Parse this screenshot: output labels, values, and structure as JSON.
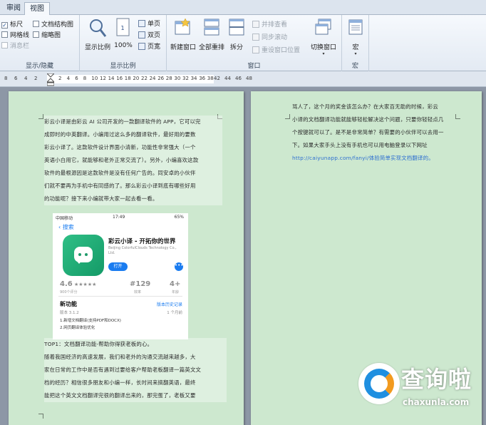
{
  "tabs": [
    {
      "label": "审阅",
      "active": false
    },
    {
      "label": "视图",
      "active": true
    }
  ],
  "ribbon": {
    "show_hide": {
      "label": "显示/隐藏",
      "ruler": {
        "label": "标尺",
        "checked": true
      },
      "gridlines": {
        "label": "网格线",
        "checked": false
      },
      "message_bar": {
        "label": "消息栏",
        "checked": false,
        "enabled": false
      },
      "doc_map": {
        "label": "文档结构图",
        "checked": false
      },
      "thumbnails": {
        "label": "缩略图",
        "checked": false
      }
    },
    "zoom": {
      "label": "显示比例",
      "zoom_button": "显示比例",
      "hundred_button": "100%",
      "one_page": "单页",
      "two_pages": "双页",
      "page_width": "页宽"
    },
    "window": {
      "label": "窗口",
      "new_window": "新建窗口",
      "arrange_all": "全部重排",
      "split": "拆分",
      "side_by_side": "并排查看",
      "sync_scroll": "同步滚动",
      "reset_position": "重设窗口位置",
      "switch_windows": "切换窗口"
    },
    "macros": {
      "label": "宏",
      "macro_button": "宏"
    }
  },
  "ruler": {
    "left_ticks": [
      "8",
      "6",
      "4",
      "2"
    ],
    "main_ticks": [
      "2",
      "4",
      "6",
      "8",
      "10",
      "12",
      "14",
      "16",
      "18",
      "20",
      "22",
      "24",
      "26",
      "28",
      "30",
      "32",
      "34",
      "36",
      "38"
    ],
    "right_ticks": [
      "42",
      "44",
      "46",
      "48"
    ]
  },
  "page1": {
    "para1_lines": [
      "彩云小译是由彩云 AI 公司开发的一款翻译软件的 APP，它可以完",
      "成即时的中英翻译。小编用过这么多的翻译软件，最好用的要数",
      "彩云小译了。这款软件设计界面小清新，功能性非常强大（一个",
      "英语小白用它，就能够和老外正常交流了）。另外，小编喜欢这款",
      "软件的最根源因是这款软件是没有任何广告的。同安卓的小伙伴",
      "们就不要再为手机中有同感的了。那么彩云小译到底有哪些好用",
      "的功能呢？接下来小编就带大家一起去看一看。"
    ],
    "para2_lines": [
      "TOP1：文档翻译功能-帮助你得获老板的心。",
      "随着我国经济的高速发展，我们和老外的沟通交流越来越多，大",
      "家在日常的工作中是否有遇到过要给客户帮助老板翻译一篇英文文",
      "档的经历？相信很多朋友和小编一样，长时间来搞翻英语，最终",
      "能把这个英文文档翻译完很的翻译出来的，那完蛋了，老板又要"
    ]
  },
  "page2": {
    "para_lines": [
      "骂人了，这个月的奖金该怎么办？在大家百无助的时候，彩云",
      "小译的文档翻译功能就能够轻松解决这个问题，只要你轻轻点几",
      "个按键就可以了。是不是非常简单？有需要的小伙伴可以去用一",
      "下。如果大家手头上没有手机也可以用电脑登录以下网址"
    ],
    "link_text": "http://caiyunapp.com/fanyi/",
    "link_suffix": "体验简单实现文档翻译的。"
  },
  "screenshot": {
    "carrier": "中国移动",
    "time": "17:49",
    "battery": "65%",
    "back_label": "搜索",
    "app_title": "彩云小译 - 开拓你的世界",
    "app_developer": "Beijing ColorfulClouds Technology Co., Ltd.",
    "open_label": "打开",
    "more_label": "•••",
    "rating": "4.6",
    "stars": "★★★★★",
    "rating_sub": "900个评分",
    "rank": "#129",
    "rank_sub": "效率",
    "age": "4+",
    "age_sub": "年龄",
    "new_features": "新功能",
    "version_history": "版本历史记录",
    "version": "版本 3.1.2",
    "ago": "1 个月前",
    "notes": [
      "1.新增文档翻译(支持PDF和DOCX)",
      "2.网页翻译体验优化"
    ]
  },
  "watermark": {
    "brand": "查询啦",
    "url": "chaxunla.com"
  }
}
